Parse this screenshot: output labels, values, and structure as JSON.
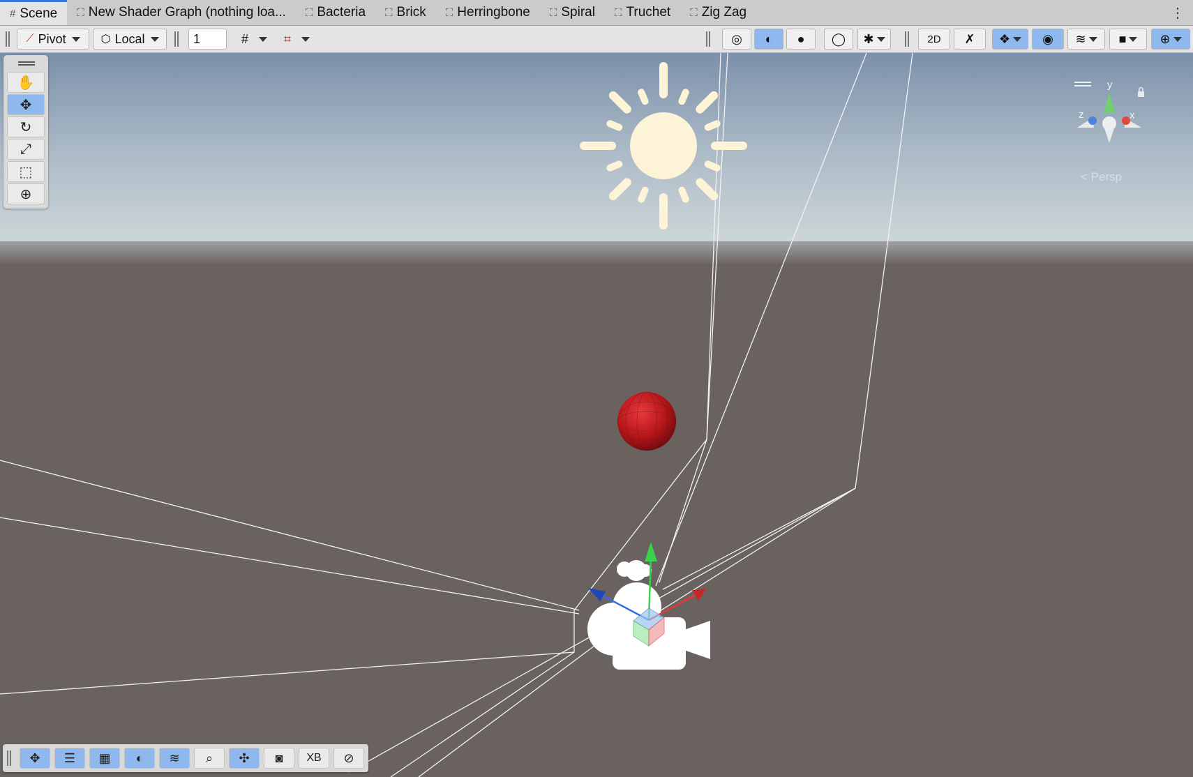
{
  "tabs": [
    {
      "label": "Scene",
      "icon": "hash-icon",
      "active": true
    },
    {
      "label": "New Shader Graph (nothing loa...",
      "icon": "shader-graph-icon"
    },
    {
      "label": "Bacteria",
      "icon": "shader-graph-icon"
    },
    {
      "label": "Brick",
      "icon": "shader-graph-icon"
    },
    {
      "label": "Herringbone",
      "icon": "shader-graph-icon"
    },
    {
      "label": "Spiral",
      "icon": "shader-graph-icon"
    },
    {
      "label": "Truchet",
      "icon": "shader-graph-icon"
    },
    {
      "label": "Zig Zag",
      "icon": "shader-graph-icon"
    }
  ],
  "toolbar": {
    "pivot_label": "Pivot",
    "local_label": "Local",
    "grid_size_value": "1"
  },
  "scene": {
    "persp_label": "< Persp",
    "gizmo_axes": {
      "y": "y",
      "x": "x",
      "z": "z"
    },
    "colors": {
      "sky_top": "#7e93ab",
      "horizon": "#c9d3d6",
      "ground": "#6b625f",
      "sun": "#fdf3d6",
      "sphere": "#b4161a",
      "selection_blue": "#8fb8ee"
    }
  },
  "bottom_toolbar": {
    "xb_label": "XB"
  }
}
